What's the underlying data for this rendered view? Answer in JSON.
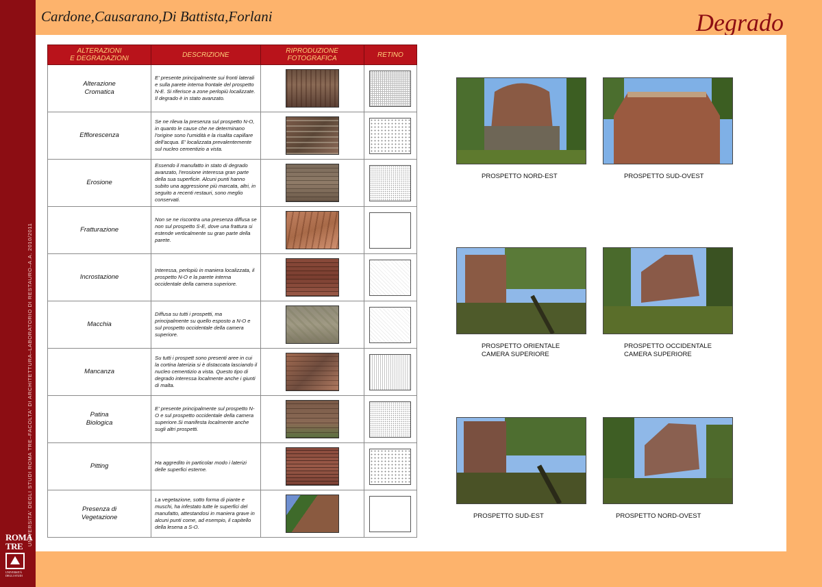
{
  "header": {
    "authors": "Cardone,Causarano,Di Battista,Forlani",
    "title": "Degrado"
  },
  "sidebar": {
    "line1": "UNIVERSITA' DEGLI STUDI ROMA TRE–FACOLTA' DI ARCHITETTURA–LABORATORIO DI RESTAURO–A.A. 2010/2011",
    "line2": "PROF. MARIA MARGARITA SEGARRA LAGUNES – STUDENTESSE: BARBARA CARDONE, FEDERICA CAUSARANO, CHIARA DI BATTISTA, SARA FORLANI",
    "logo_line1": "ROMA",
    "logo_line2": "TRE",
    "logo_sub": "UNIVERSITÀ DEGLI STUDI"
  },
  "table": {
    "headers": [
      "ALTERAZIONI\nE DEGRADAZIONI",
      "DESCRIZIONE",
      "RIPRODUZIONE\nFOTOGRAFICA",
      "RETINO"
    ],
    "rows": [
      {
        "name": "Alterazione\nCromatica",
        "desc": "E' presente principalmente sui fronti laterali e sulla parete interna frontale del prospetto N-E. Si riferisce a zone perlopiù localizzate. Il degrado è in stato avanzato.",
        "texture": "tx-cromatica",
        "hatch": "sw-dense"
      },
      {
        "name": "Efflorescenza",
        "desc": "Se ne rileva la presenza  sul prospetto N-O, in quanto le cause che ne determinano l'origine sono l'umidità e la risalita capillare dell'acqua. E' localizzata prevalentemente sul nucleo cementizio a vista.",
        "texture": "tx-efflor",
        "hatch": "sw-dots"
      },
      {
        "name": "Erosione",
        "desc": "Essendo il manufatto in stato di degrado avanzato, l'erosione interessa gran parte della sua superficie. Alcuni punti hanno subito una aggressione più marcata, altri, in seguito a recenti restauri, sono meglio conservati.",
        "texture": "tx-erosione",
        "hatch": "sw-fine"
      },
      {
        "name": "Fratturazione",
        "desc": "Non se ne riscontra una presenza diffusa se non sul prospetto S-E, dove una frattura si estende verticalmente su gran parte della parete.",
        "texture": "tx-fratt",
        "hatch": "sw-blank"
      },
      {
        "name": "Incrostazione",
        "desc": "Interessa, perlopiù in maniera localizzata, il prospetto N-O e la parete interna occidentale della camera superiore.",
        "texture": "tx-incro",
        "hatch": "sw-faint"
      },
      {
        "name": "Macchia",
        "desc": "Diffusa su tutti i prospetti, ma principalmente su quello esposto a N-O e sul prospetto occidentale della camera superiore.",
        "texture": "tx-macchia",
        "hatch": "sw-faint"
      },
      {
        "name": "Mancanza",
        "desc": "Su tutti i prospett sono presenti aree in cui la cortina laterizia si è distaccata lasciando il nucleo cementizio a vista. Questo tipo di degrado interessa localmente anche i giunti di malta.",
        "texture": "tx-manc",
        "hatch": "sw-vlines"
      },
      {
        "name": "Patina\nBiologica",
        "desc": "E' presente principalmente sul prospetto N-O e sul prospetto occidentale della camera superiore.Si manifesta localmente anche sugli altri prospetti.",
        "texture": "tx-patina",
        "hatch": "sw-fine"
      },
      {
        "name": "Pitting",
        "desc": "Ha aggredito in particolar modo i laterizi delle superfici esterne.",
        "texture": "tx-pitting",
        "hatch": "sw-dots"
      },
      {
        "name": "Presenza di\nVegetazione",
        "desc": "La vegetazione, sotto forma di piante e muschi, ha infestato tutte le superfici del manufatto, attestandosi in maniera grave in alcuni punti come, ad esempio, il capitello della lesena a S-O.",
        "texture": "tx-veget",
        "hatch": "sw-blank"
      }
    ]
  },
  "photos": [
    {
      "caption": "PROSPETTO NORD-EST"
    },
    {
      "caption": "PROSPETTO SUD-OVEST"
    },
    {
      "caption": "PROSPETTO ORIENTALE\nCAMERA SUPERIORE"
    },
    {
      "caption": "PROSPETTO OCCIDENTALE\nCAMERA SUPERIORE"
    },
    {
      "caption": "PROSPETTO SUD-EST"
    },
    {
      "caption": "PROSPETTO NORD-OVEST"
    }
  ]
}
